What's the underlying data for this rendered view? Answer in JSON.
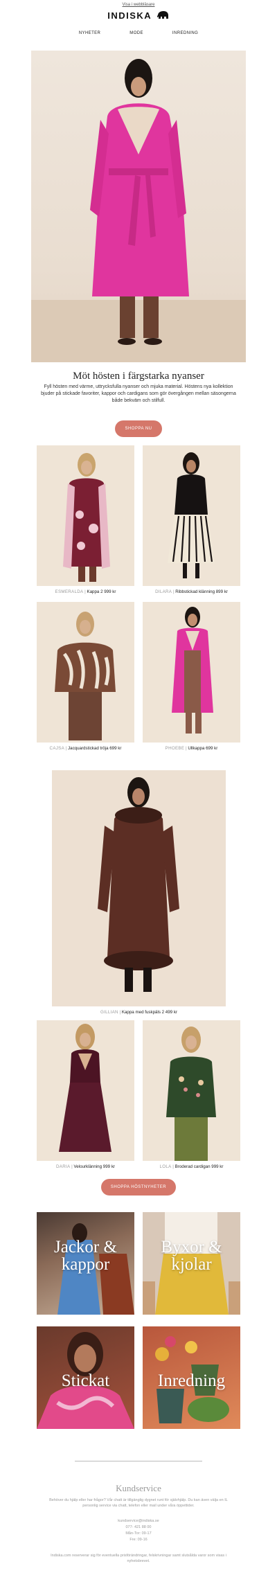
{
  "header": {
    "view_in_browser": "Visa i webbläsare",
    "brand": "INDISKA",
    "nav": [
      "NYHETER",
      "MODE",
      "INREDNING"
    ]
  },
  "hero": {
    "title": "Möt hösten i färgstarka nyanser",
    "body": "Fyll hösten med värme, uttrycksfulla nyanser och mjuka material. Höstens nya kollektion bjuder på stickade favoriter, kappor och cardigans som gör övergången mellan säsongerna både bekväm och stilfull.",
    "cta": "SHOPPA NU"
  },
  "products": [
    {
      "name": "ESMERALDA",
      "desc": "Kappa 2 999 kr"
    },
    {
      "name": "DILARA",
      "desc": "Ribbstickad klänning 899 kr"
    },
    {
      "name": "CAJSA",
      "desc": "Jacquardstickad tröja 699 kr"
    },
    {
      "name": "PHOEBE",
      "desc": "Ullkappa 699 kr"
    },
    {
      "name": "GILLIAN",
      "desc": "Kappa med fuskpäls 2 499 kr"
    },
    {
      "name": "DARIA",
      "desc": "Velourklänning 999 kr"
    },
    {
      "name": "LOLA",
      "desc": "Broderad cardigan 999 kr"
    }
  ],
  "cta_news": "SHOPPA HÖSTNYHETER",
  "categories": [
    {
      "label": "Jackor & kappor"
    },
    {
      "label": "Byxor & kjolar"
    },
    {
      "label": "Stickat"
    },
    {
      "label": "Inredning"
    }
  ],
  "footer": {
    "title": "Kundservice",
    "text": "Behöver du hjälp eller har frågor? Vår chatt är tillgänglig dygnet runt för självhjälp. Du kan även välja en IL personlig service via chatt, telefon eller mail under våra öppettider.",
    "email": "kundservice@indiska.se",
    "phone": "077- 421 88 00",
    "hours_weekday": "Mån-Tor: 09-17",
    "hours_friday": "Fre: 09-16",
    "legal": "Indiska.com reserverar sig för eventuella prisförändringar, felskrivningar samt slutsålda varor som visas i nyhetsbrevet."
  },
  "colors": {
    "accent": "#d5776a",
    "hero_coat": "#e0359e"
  }
}
